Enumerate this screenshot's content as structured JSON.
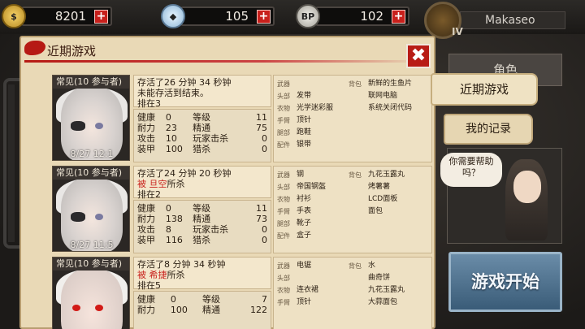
{
  "resources": {
    "gold": {
      "icon": "gold-coins-icon",
      "value": "8201"
    },
    "gems": {
      "icon": "diamond-icon",
      "value": "105"
    },
    "bp": {
      "icon": "bp-badge-icon",
      "badge": "BP",
      "value": "102"
    }
  },
  "player": {
    "name": "Makaseo",
    "level": "IV"
  },
  "panel": {
    "title": "近期游戏"
  },
  "stat_labels": {
    "health": "健康",
    "level": "等级",
    "endurance": "耐力",
    "precision": "精通",
    "attack": "攻击",
    "player_kills": "玩家击杀",
    "armor": "装甲",
    "hunt": "猎杀"
  },
  "equip_labels": {
    "weapon": "武器",
    "head": "头部",
    "body": "衣物",
    "hands": "手臂",
    "legs": "腿部",
    "accessory": "配件",
    "bag": "背包"
  },
  "games": [
    {
      "tag": "常见(10 参与者)",
      "date": "8/27 12:1",
      "survived": "存活了26 分钟 34 秒钟",
      "line2": "未能存活到结束。",
      "killer": "",
      "killed_suffix": "",
      "rank": "排在3",
      "stats": {
        "health": "0",
        "level": "11",
        "endurance": "23",
        "precision": "75",
        "attack": "10",
        "player_kills": "0",
        "armor": "100",
        "hunt": "0"
      },
      "equip": {
        "weapon": "",
        "head": "发带",
        "body": "光学迷彩服",
        "hands": "顶针",
        "legs": "跑鞋",
        "accessory": "银带"
      },
      "bag": [
        "新鲜的生鱼片",
        "联网电脑",
        "系统关闭代码"
      ]
    },
    {
      "tag": "常见(10 参与者)",
      "date": "8/27 11:5",
      "survived": "存活了24 分钟 20 秒钟",
      "line2": "",
      "killer": "被 旦空",
      "killed_suffix": "所杀",
      "rank": "排在2",
      "stats": {
        "health": "0",
        "level": "11",
        "endurance": "138",
        "precision": "73",
        "attack": "8",
        "player_kills": "0",
        "armor": "116",
        "hunt": "0"
      },
      "equip": {
        "weapon": "钢",
        "head": "帝国钢盔",
        "body": "衬衫",
        "hands": "手表",
        "legs": "靴子",
        "accessory": "盒子"
      },
      "bag": [
        "九花玉露丸",
        "烤薯薯",
        "LCD面板",
        "面包"
      ]
    },
    {
      "tag": "常见(10 参与者)",
      "date": "",
      "survived": "存活了8 分钟 34 秒钟",
      "line2": "",
      "killer": "被 希捷",
      "killed_suffix": "所杀",
      "rank": "排在5",
      "stats": {
        "health": "0",
        "level": "7",
        "endurance": "100",
        "precision": "122",
        "attack": "",
        "player_kills": "",
        "armor": "",
        "hunt": ""
      },
      "equip": {
        "weapon": "电锯",
        "head": "",
        "body": "连衣裙",
        "hands": "顶针",
        "legs": "",
        "accessory": ""
      },
      "bag": [
        "水",
        "曲奇饼",
        "九花玉露丸",
        "大蒜面包"
      ]
    }
  ],
  "side": {
    "char_card": "角色",
    "tab_recent": "近期游戏",
    "tab_records": "我的记录",
    "help": "你需要帮助吗？",
    "start": "游戏开始"
  },
  "colors": {
    "accent_red": "#c8201c",
    "parchment": "#e9d9b6",
    "start_blue": "#4f7390"
  }
}
